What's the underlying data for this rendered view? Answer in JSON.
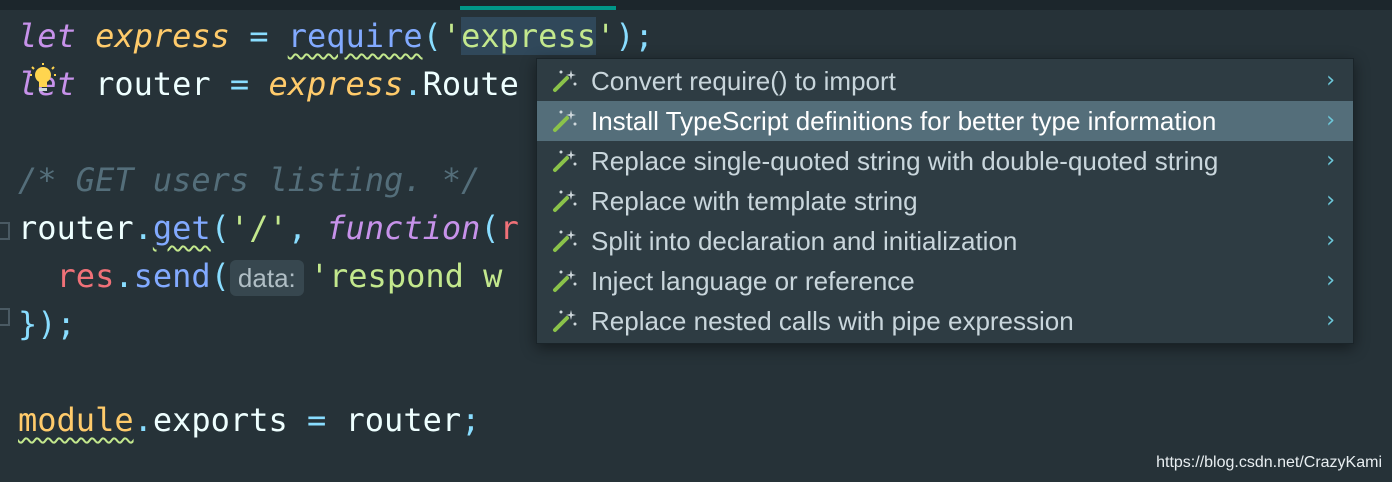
{
  "code": {
    "l1": {
      "kw": "let",
      "var": "express",
      "op": " = ",
      "fn": "require",
      "p1": "(",
      "q1": "'",
      "word": "express",
      "q2": "'",
      "p2": ");"
    },
    "l2": {
      "kw": "let",
      "name": "router",
      "op": " = ",
      "var": "express",
      "dot": ".",
      "rest": "Route"
    },
    "l4": {
      "comment": "/* GET users listing. */"
    },
    "l5": {
      "obj": "router",
      "dot": ".",
      "fn": "get",
      "p1": "(",
      "arg": "'/'",
      "comma": ", ",
      "kw": "function",
      "p2": "(",
      "rest": "r"
    },
    "l6": {
      "obj": "res",
      "dot": ".",
      "fn": "send",
      "p1": "(",
      "hint": "data:",
      "str": "'respond w"
    },
    "l7": {
      "close": "});"
    },
    "l9": {
      "obj": "module",
      "dot": ".",
      "prop": "exports",
      "op": " = ",
      "val": "router",
      "semi": ";"
    }
  },
  "intentions": {
    "items": [
      {
        "label": "Convert require() to import",
        "selected": false,
        "icon": "magic-wand-icon"
      },
      {
        "label": "Install TypeScript definitions for better type information",
        "selected": true,
        "icon": "magic-wand-icon"
      },
      {
        "label": "Replace single-quoted string with double-quoted string",
        "selected": false,
        "icon": "magic-wand-icon"
      },
      {
        "label": "Replace with template string",
        "selected": false,
        "icon": "magic-wand-icon"
      },
      {
        "label": "Split into declaration and initialization",
        "selected": false,
        "icon": "magic-wand-icon"
      },
      {
        "label": "Inject language or reference",
        "selected": false,
        "icon": "magic-wand-icon"
      },
      {
        "label": "Replace nested calls with pipe expression",
        "selected": false,
        "icon": "magic-wand-icon"
      }
    ],
    "chevron": "›"
  },
  "icons": {
    "bulb": "lightbulb-icon",
    "wand": "magic-wand-icon",
    "chevron": "chevron-right-icon"
  },
  "colors": {
    "background": "#263238",
    "selected": "#546e7a",
    "keyword": "#c792ea",
    "string": "#c3e88d",
    "function": "#82aaff",
    "variable": "#ffcb6b"
  },
  "watermark": "https://blog.csdn.net/CrazyKami"
}
